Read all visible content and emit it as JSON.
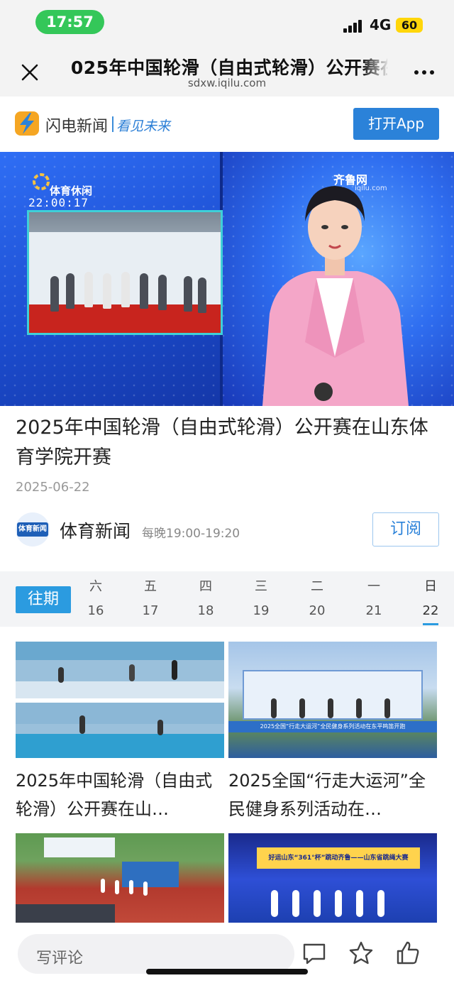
{
  "status_bar": {
    "time": "17:57",
    "network": "4G",
    "battery": "60"
  },
  "nav": {
    "title": "2025年中国轮滑（自由式轮滑）公开赛在山东体育学院开赛",
    "url": "sdxw.iqilu.com"
  },
  "app_banner": {
    "brand_name": "闪电新闻",
    "slogan": "看见未来",
    "open_button": "打开App"
  },
  "video": {
    "channel_name": "体育休闲",
    "timecode": "22:00:17",
    "station_logo": "齐鲁网",
    "station_url": "iqilu.com"
  },
  "article": {
    "title": "2025年中国轮滑（自由式轮滑）公开赛在山东体育学院开赛",
    "date": "2025-06-22"
  },
  "program": {
    "avatar_text": "体育新闻",
    "name": "体育新闻",
    "schedule": "每晚19:00-19:20",
    "subscribe_button": "订阅"
  },
  "schedule": {
    "label": "往期",
    "days": [
      {
        "weekday": "六",
        "date": "16"
      },
      {
        "weekday": "五",
        "date": "17"
      },
      {
        "weekday": "四",
        "date": "18"
      },
      {
        "weekday": "三",
        "date": "19"
      },
      {
        "weekday": "二",
        "date": "20"
      },
      {
        "weekday": "一",
        "date": "21"
      },
      {
        "weekday": "日",
        "date": "22"
      }
    ],
    "active_index": 6
  },
  "grid": [
    {
      "title": "2025年中国轮滑（自由式轮滑）公开赛在山…"
    },
    {
      "title": "2025全国“行走大运河”全民健身系列活动在…",
      "banner_text": "2025全国“行走大运河”全民健身系列活动在东平鸣笛开跑"
    },
    {
      "title": ""
    },
    {
      "title": "",
      "banner_text": "好运山东“361°杯”跳动齐鲁——山东省跳绳大赛"
    }
  ],
  "bottom_bar": {
    "comment_placeholder": "写评论"
  },
  "colors": {
    "accent": "#2b82d9",
    "tab_accent": "#2b9be0",
    "status_green": "#34c759",
    "battery_yellow": "#ffd60a"
  }
}
